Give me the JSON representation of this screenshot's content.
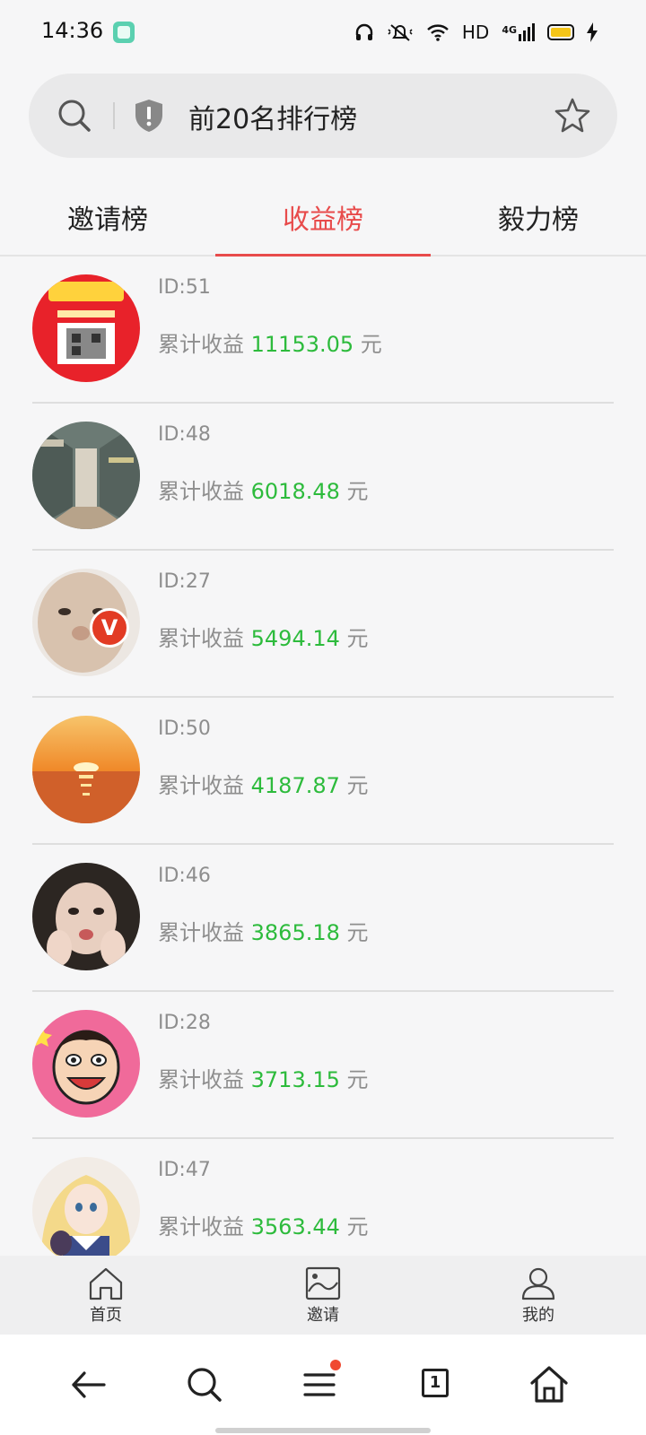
{
  "status_bar": {
    "time": "14:36",
    "hd": "HD",
    "network": "4G",
    "icons": [
      "app-icon",
      "headset-icon",
      "mute-icon",
      "wifi-icon",
      "signal-icon",
      "battery-icon",
      "charging-icon"
    ]
  },
  "search_bar": {
    "title": "前20名排行榜",
    "icons": [
      "search-icon",
      "shield-icon",
      "star-icon"
    ]
  },
  "tabs": [
    {
      "label": "邀请榜",
      "active": false
    },
    {
      "label": "收益榜",
      "active": true
    },
    {
      "label": "毅力榜",
      "active": false
    }
  ],
  "leaderboard": {
    "earn_prefix": "累计收益",
    "earn_unit": "元",
    "items": [
      {
        "id": "ID:51",
        "amount": "11153.05"
      },
      {
        "id": "ID:48",
        "amount": "6018.48"
      },
      {
        "id": "ID:27",
        "amount": "5494.14"
      },
      {
        "id": "ID:50",
        "amount": "4187.87"
      },
      {
        "id": "ID:46",
        "amount": "3865.18"
      },
      {
        "id": "ID:28",
        "amount": "3713.15"
      },
      {
        "id": "ID:47",
        "amount": "3563.44"
      }
    ]
  },
  "app_nav": {
    "items": [
      {
        "label": "首页",
        "icon": "home-icon"
      },
      {
        "label": "邀请",
        "icon": "invite-icon"
      },
      {
        "label": "我的",
        "icon": "profile-icon"
      }
    ]
  },
  "browser_bar": {
    "tab_count": "1",
    "icons": [
      "back-arrow-icon",
      "search-icon",
      "menu-icon",
      "tabs-icon",
      "home-icon"
    ]
  },
  "colors": {
    "accent": "#e84b4b",
    "amount": "#2dbb3c",
    "muted": "#8e8e8e"
  }
}
